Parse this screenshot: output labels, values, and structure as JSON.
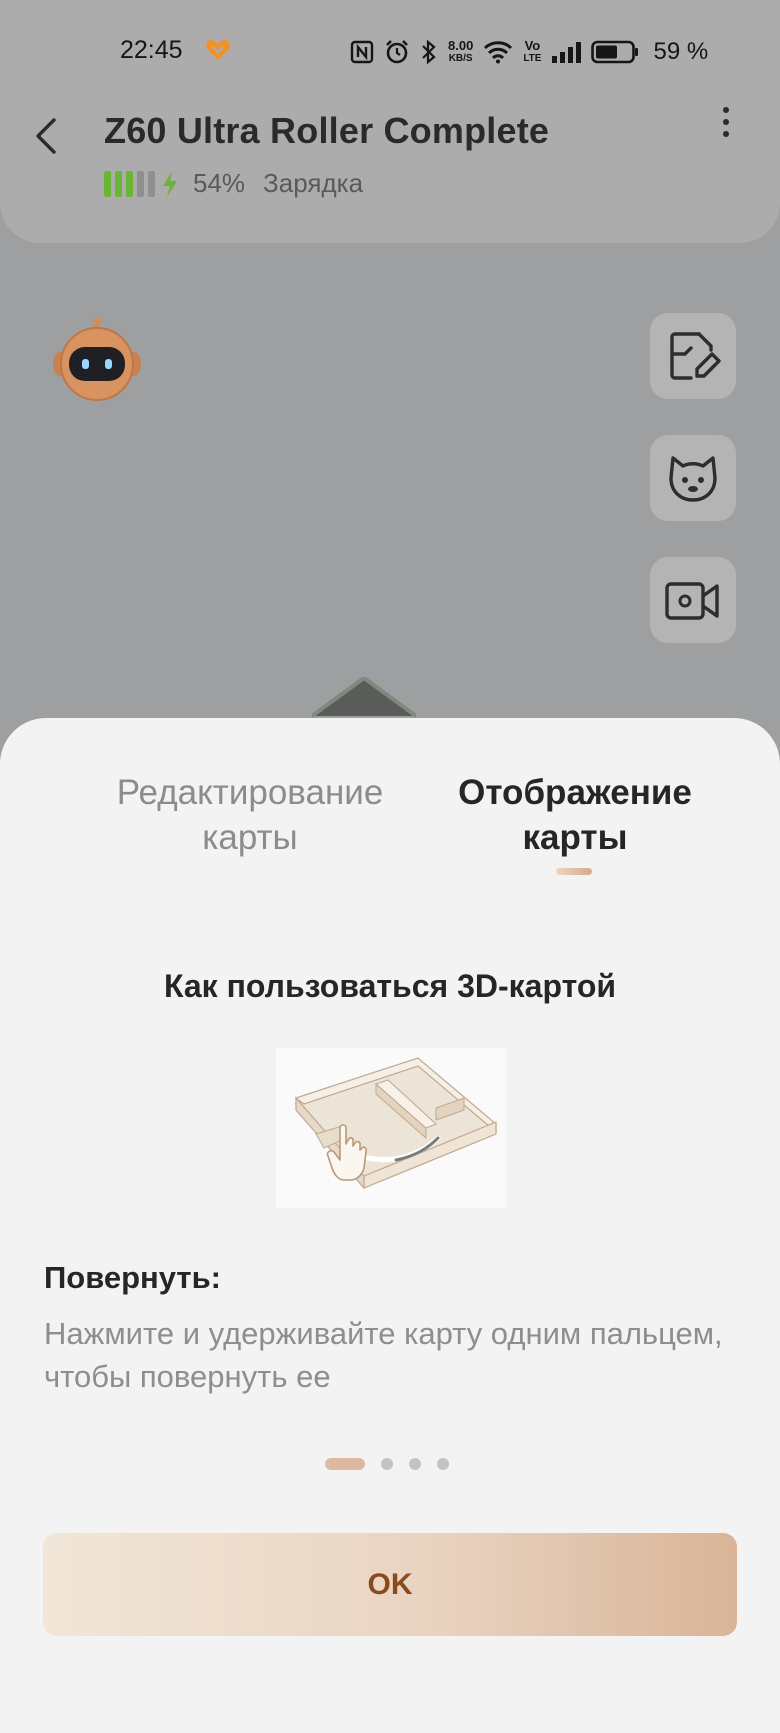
{
  "status_bar": {
    "time": "22:45",
    "net_speed_value": "8.00",
    "net_speed_unit": "KB/S",
    "volte_top": "Vo",
    "volte_bottom": "LTE",
    "battery_percent": "59 %",
    "icons": [
      "heart-icon",
      "nfc-icon",
      "alarm-icon",
      "bluetooth-icon",
      "wifi-icon",
      "volte-icon",
      "signal-icon",
      "battery-icon"
    ]
  },
  "header": {
    "title": "Z60 Ultra Roller Complete",
    "battery_percent": "54%",
    "battery_status": "Зарядка",
    "battery_level": 0.54,
    "battery_color": "#6bb536"
  },
  "side_buttons": [
    "map-edit-icon",
    "pet-icon",
    "video-camera-icon"
  ],
  "sheet": {
    "tabs": [
      {
        "label": "Редактирование карты",
        "active": false
      },
      {
        "label": "Отображение карты",
        "active": true
      }
    ],
    "howto_title": "Как пользоваться 3D-картой",
    "step_title": "Повернуть:",
    "step_description": "Нажмите и удерживайте карту одним пальцем, чтобы повернуть ее",
    "pager": {
      "total": 4,
      "current": 1
    },
    "ok_label": "OK",
    "accent_color": "#d6aa8a"
  }
}
